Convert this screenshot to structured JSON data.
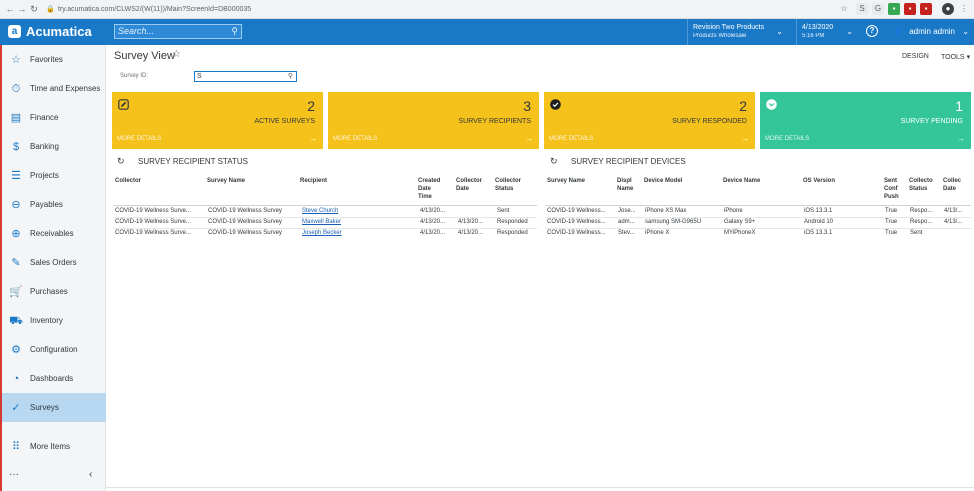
{
  "browser": {
    "url": "try.acumatica.com/CLWS2/(W(11))/Main?ScreenId=DB000035"
  },
  "app": {
    "brand": "Acumatica",
    "search_placeholder": "Search...",
    "company": "Revision Two Products",
    "branch": "Products Wholesale",
    "date": "4/13/2020",
    "time": "5:16 PM",
    "help": "?",
    "user": "admin admin"
  },
  "sidebar": {
    "items": [
      {
        "label": "Favorites",
        "icon": "star-icon"
      },
      {
        "label": "Time and Expenses",
        "icon": "clock-icon"
      },
      {
        "label": "Finance",
        "icon": "finance-icon"
      },
      {
        "label": "Banking",
        "icon": "dollar-icon"
      },
      {
        "label": "Projects",
        "icon": "projects-icon"
      },
      {
        "label": "Payables",
        "icon": "minus-circle-icon"
      },
      {
        "label": "Receivables",
        "icon": "plus-circle-icon"
      },
      {
        "label": "Sales Orders",
        "icon": "sales-orders-icon"
      },
      {
        "label": "Purchases",
        "icon": "cart-icon"
      },
      {
        "label": "Inventory",
        "icon": "truck-icon"
      },
      {
        "label": "Configuration",
        "icon": "gear-icon"
      },
      {
        "label": "Dashboards",
        "icon": "dashboard-icon"
      },
      {
        "label": "Surveys",
        "icon": "check-circle-icon"
      },
      {
        "label": "More Items",
        "icon": "grid-icon"
      }
    ],
    "active": "Surveys"
  },
  "page": {
    "title": "Survey View",
    "design": "DESIGN",
    "tools": "TOOLS",
    "survey_id_label": "Survey ID:",
    "survey_id_value": "S"
  },
  "tiles": [
    {
      "count": "2",
      "label": "ACTIVE SURVEYS",
      "more": "MORE DETAILS",
      "color": "#f5c11b",
      "icon": "edit-icon"
    },
    {
      "count": "3",
      "label": "SURVEY RECIPIENTS",
      "more": "MORE DETAILS",
      "color": "#f5c11b",
      "icon": ""
    },
    {
      "count": "2",
      "label": "SURVEY RESPONDED",
      "more": "MORE DETAILS",
      "color": "#f5c11b",
      "icon": "check-circle-icon"
    },
    {
      "count": "1",
      "label": "SURVEY PENDING",
      "more": "MORE DETAILS",
      "color": "#34c698",
      "icon": "chevron-down-circle-icon"
    }
  ],
  "status_section": {
    "title": "SURVEY RECIPIENT STATUS",
    "columns": [
      "Collector",
      "Survey Name",
      "Recipient",
      "Created\nDate\nTime",
      "Collector\nDate",
      "Collector\nStatus"
    ],
    "rows": [
      [
        "COVID-19 Wellness Surve...",
        "COVID-19 Wellness Survey",
        "Steve Church",
        "4/13/20...",
        "",
        "Sent"
      ],
      [
        "COVID-19 Wellness Surve...",
        "COVID-19 Wellness Survey",
        "Maxwell Baker",
        "4/13/20...",
        "4/13/20...",
        "Responded"
      ],
      [
        "COVID-19 Wellness Surve...",
        "COVID-19 Wellness Survey",
        "Joseph Becker",
        "4/13/20...",
        "4/13/20...",
        "Responded"
      ]
    ]
  },
  "devices_section": {
    "title": "SURVEY RECIPIENT DEVICES",
    "columns": [
      "Survey Name",
      "Displ\nName",
      "Device Model",
      "Device Name",
      "OS Version",
      "Sent\nConf\nPush",
      "Collecto\nStatus",
      "Collec\nDate"
    ],
    "rows": [
      [
        "COVID-19 Wellness...",
        "Jose...",
        "iPhone XS Max",
        "iPhone",
        "iOS 13.3.1",
        "True",
        "Respo...",
        "4/13/..."
      ],
      [
        "COVID-19 Wellness...",
        "adm...",
        "samsung SM-G965U",
        "Galaxy S9+",
        "Android 10",
        "True",
        "Respo...",
        "4/13/..."
      ],
      [
        "COVID-19 Wellness...",
        "Stev...",
        "iPhone X",
        "MYiPhoneX",
        "iOS 13.3.1",
        "True",
        "Sent",
        ""
      ]
    ]
  }
}
